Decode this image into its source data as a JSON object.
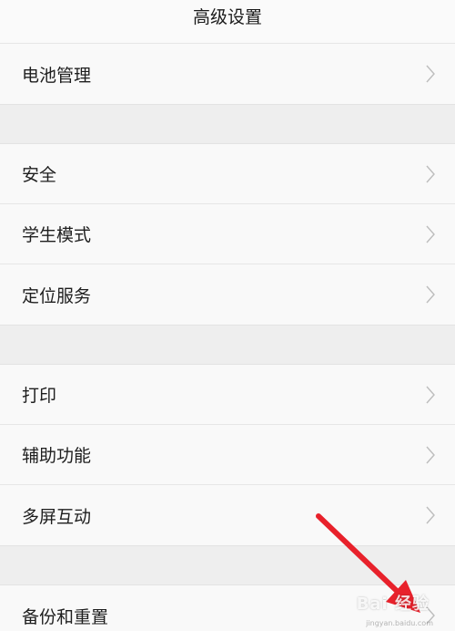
{
  "header": {
    "title": "高级设置"
  },
  "groups": [
    {
      "items": [
        {
          "label": "电池管理"
        }
      ]
    },
    {
      "items": [
        {
          "label": "安全"
        },
        {
          "label": "学生模式"
        },
        {
          "label": "定位服务"
        }
      ]
    },
    {
      "items": [
        {
          "label": "打印"
        },
        {
          "label": "辅助功能"
        },
        {
          "label": "多屏互动"
        }
      ]
    },
    {
      "items": [
        {
          "label": "备份和重置"
        }
      ]
    }
  ],
  "icons": {
    "row_chevron": "chevron-right-icon",
    "annotation": "red-arrow-icon"
  },
  "colors": {
    "annotation_arrow": "#e8212b"
  },
  "watermark": {
    "text": "Bai 经验",
    "subtext": "jingyan.baidu.com"
  }
}
